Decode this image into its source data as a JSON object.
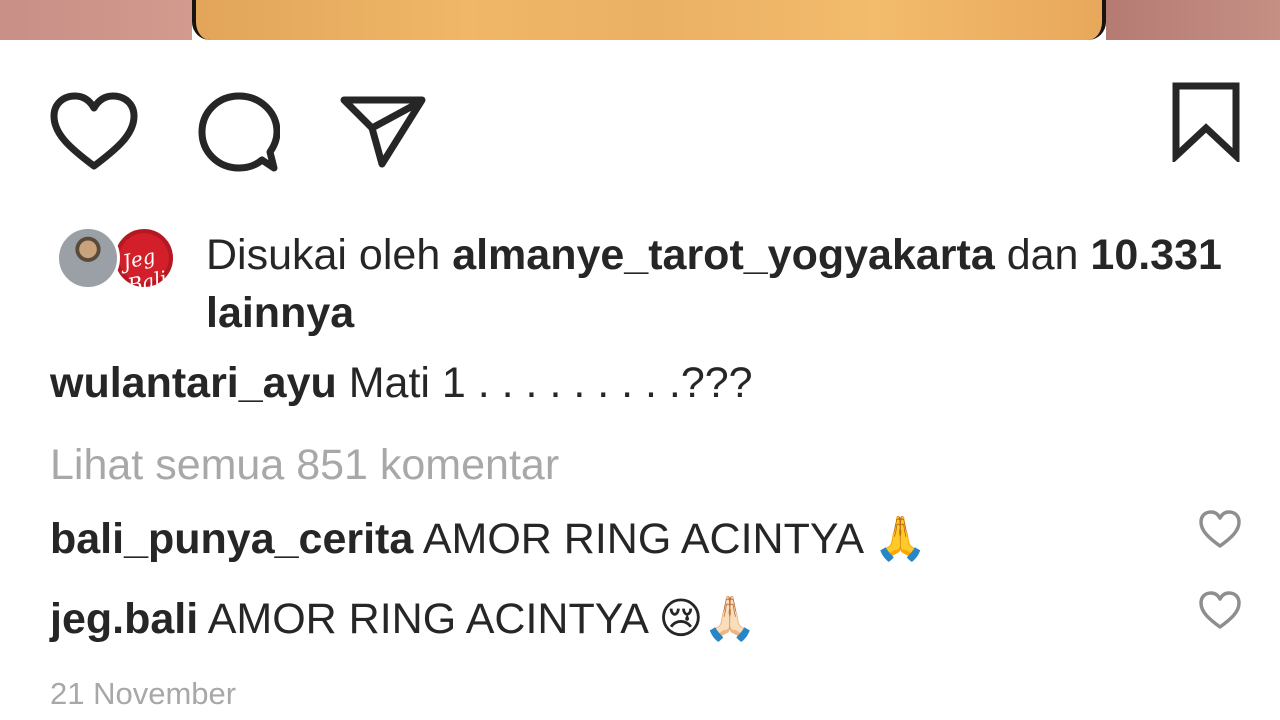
{
  "post": {
    "likes": {
      "prefix": "Disukai oleh",
      "user": "almanye_tarot_yogyakarta",
      "conj": "dan",
      "count_text": "10.331 lainnya"
    },
    "caption": {
      "user": "wulantari_ayu",
      "text": "Mati 1 . . . . . . . . .???"
    },
    "view_all": "Lihat semua 851 komentar",
    "comments": [
      {
        "user": "bali_punya_cerita",
        "text": "AMOR RING ACINTYA",
        "emoji": "🙏"
      },
      {
        "user": "jeg.bali",
        "text": "AMOR RING ACINTYA",
        "emoji": "😢🙏🏻"
      }
    ],
    "date": "21 November",
    "avatar_labels": [
      "",
      "Jeg Bali"
    ]
  },
  "icons": {
    "like": "heart-icon",
    "comment": "comment-icon",
    "share": "send-icon",
    "save": "bookmark-icon",
    "comment_like": "small-heart-icon"
  },
  "colors": {
    "text": "#262626",
    "muted": "#a8a8a8"
  }
}
